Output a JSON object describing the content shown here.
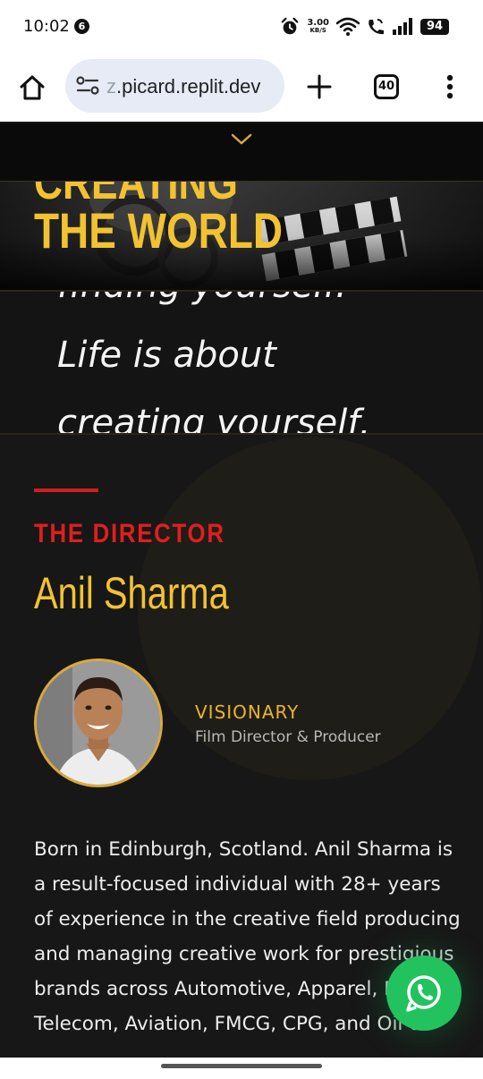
{
  "status_bar": {
    "time": "10:02",
    "notification_count": "6",
    "net_speed_value": "3.00",
    "net_speed_unit": "KB/S",
    "battery": "94"
  },
  "browser": {
    "url_prefix": "z",
    "url_main": ".picard.replit.dev",
    "tab_count": "40"
  },
  "hero": {
    "title_partial": "CREATING",
    "title": "THE WORLD"
  },
  "quote": {
    "line_partial": "finding yourself.",
    "line_1": "Life is about",
    "line_2": "creating yourself."
  },
  "director": {
    "label": "THE DIRECTOR",
    "name": "Anil Sharma",
    "role_title": "VISIONARY",
    "role_subtitle": "Film Director & Producer",
    "bio": "Born in Edinburgh, Scotland. Anil Sharma is a result-focused individual with 28+ years of experience in the creative field producing and managing creative work for prestigious brands across Automotive, Apparel, Fashion, Telecom, Aviation, FMCG, CPG, and Oil &"
  },
  "colors": {
    "accent_gold": "#f2c230",
    "accent_red": "#e01e1e",
    "background_dark": "#151515",
    "whatsapp_green": "#22c35e"
  },
  "icons": {
    "notification": "notification-badge-icon",
    "alarm": "alarm-icon",
    "wifi": "wifi-icon",
    "call": "wifi-calling-icon",
    "signal": "signal-icon",
    "home": "home-icon",
    "site_settings": "tune-icon",
    "new_tab": "plus-icon",
    "tabs": "tab-switcher-icon",
    "menu": "more-vert-icon",
    "scroll": "chevron-down-icon",
    "whatsapp": "whatsapp-icon"
  }
}
